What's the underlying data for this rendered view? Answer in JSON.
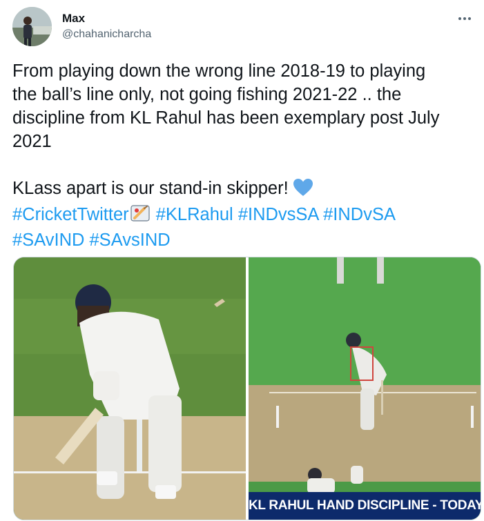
{
  "author": {
    "name": "Max",
    "handle": "@chahanicharcha"
  },
  "tweet": {
    "line1": "From playing down the wrong line 2018-19 to playing",
    "line2": "the ball’s line only, not going fishing 2021-22 .. the",
    "line3": "discipline from KL Rahul has been exemplary post July",
    "line4": "2021",
    "line5": "KLass apart is our stand-in skipper!",
    "heart_emoji": "blue-heart",
    "hashtags": [
      "#CricketTwitter",
      "#KLRahul",
      "#INDvsSA",
      "#INDvSA",
      "#SAvIND",
      "#SAvsIND"
    ],
    "bat_emoji": "cricket-bat-ball"
  },
  "media": {
    "right_caption": "KL RAHUL HAND DISCIPLINE - TODAY"
  },
  "colors": {
    "link": "#1d9bf0",
    "text": "#0f1419",
    "secondary": "#536471",
    "caption_bg": "#0d2a6b"
  }
}
